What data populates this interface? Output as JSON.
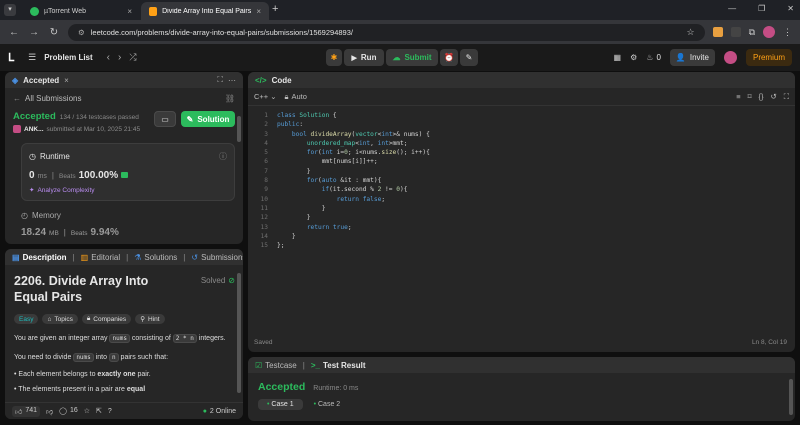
{
  "browser": {
    "tabs": [
      {
        "title": "µTorrent Web",
        "close": "×"
      },
      {
        "title": "Divide Array Into Equal Pairs - L",
        "close": "×"
      }
    ],
    "new_tab": "+",
    "url": "leetcode.com/problems/divide-array-into-equal-pairs/submissions/1569294893/"
  },
  "topnav": {
    "problem_list": "Problem List",
    "run": "Run",
    "submit": "Submit",
    "notif_count": "0",
    "invite": "Invite",
    "premium": "Premium"
  },
  "left": {
    "tab_title": "Accepted",
    "tab_close": "×",
    "back": "All Submissions",
    "status": "Accepted",
    "testcases": "134 / 134 testcases passed",
    "user": "ANK...",
    "submitted": "submitted at Mar 10, 2025 21:45",
    "solution_btn": "Solution",
    "runtime_label": "Runtime",
    "runtime_value": "0",
    "runtime_unit": "ms",
    "beats_label": "Beats",
    "beats_value": "100.00%",
    "analyze": "Analyze Complexity",
    "memory_label": "Memory",
    "memory_value": "18.24",
    "memory_unit": "MB",
    "memory_beats_label": "Beats",
    "memory_beats": "9.94%"
  },
  "desc": {
    "tabs": [
      "Description",
      "Editorial",
      "Solutions",
      "Submissions"
    ],
    "title": "2206. Divide Array Into Equal Pairs",
    "solved": "Solved",
    "tags": [
      "Easy",
      "Topics",
      "Companies",
      "Hint"
    ],
    "p1a": "You are given an integer array",
    "p1code": "nums",
    "p1b": "consisting of",
    "p1code2": "2 * n",
    "p1c": "integers.",
    "p2a": "You need to divide",
    "p2code": "nums",
    "p2b": "into",
    "p2code2": "n",
    "p2c": "pairs such that:",
    "b1a": "Each element belongs to",
    "b1b": "exactly one",
    "b1c": "pair.",
    "b2a": "The elements present in a pair are",
    "b2b": "equal",
    "likes": "741",
    "comments": "16",
    "online": "2 Online"
  },
  "code": {
    "title": "Code",
    "lang": "C++",
    "auto": "Auto",
    "saved": "Saved",
    "cursor": "Ln 8, Col 19",
    "line_numbers": [
      "1",
      "2",
      "3",
      "4",
      "5",
      "6",
      "7",
      "8",
      "9",
      "10",
      "11",
      "12",
      "13",
      "14",
      "15"
    ]
  },
  "result": {
    "testcase_tab": "Testcase",
    "result_tab": "Test Result",
    "status": "Accepted",
    "runtime": "Runtime: 0 ms",
    "cases": [
      "Case 1",
      "Case 2"
    ]
  },
  "colors": {
    "accent_green": "#2cbb5d",
    "orange": "#ffa116",
    "premium": "#ffa116"
  }
}
